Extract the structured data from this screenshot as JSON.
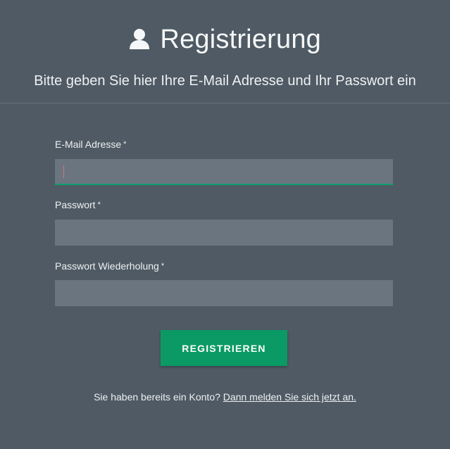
{
  "header": {
    "title": "Registrierung",
    "icon": "user-icon",
    "subtitle": "Bitte geben Sie hier Ihre E-Mail Adresse und Ihr Passwort ein"
  },
  "form": {
    "email": {
      "label": "E-Mail Adresse",
      "required_marker": "*",
      "value": "",
      "placeholder": ""
    },
    "password": {
      "label": "Passwort",
      "required_marker": "*",
      "value": "",
      "placeholder": ""
    },
    "password_repeat": {
      "label": "Passwort Wiederholung",
      "required_marker": "*",
      "value": "",
      "placeholder": ""
    },
    "submit_label": "REGISTRIEREN"
  },
  "footer": {
    "text": "Sie haben bereits ein Konto?",
    "link_text": "Dann melden Sie sich jetzt an."
  },
  "colors": {
    "background": "#4f5a64",
    "input_background": "#6b757f",
    "accent": "#0b9a65"
  }
}
